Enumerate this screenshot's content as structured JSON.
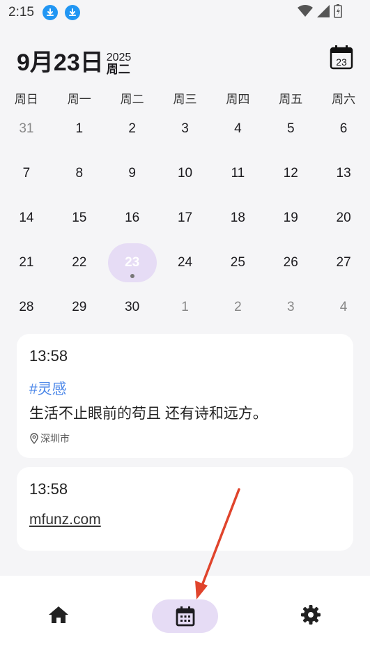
{
  "status": {
    "time": "2:15"
  },
  "header": {
    "date": "9月23日",
    "year": "2025",
    "weekday": "周二",
    "cal_icon_day": "23"
  },
  "weekdays": [
    "周日",
    "周一",
    "周二",
    "周三",
    "周四",
    "周五",
    "周六"
  ],
  "calendar": {
    "rows": [
      [
        "31",
        "1",
        "2",
        "3",
        "4",
        "5",
        "6"
      ],
      [
        "7",
        "8",
        "9",
        "10",
        "11",
        "12",
        "13"
      ],
      [
        "14",
        "15",
        "16",
        "17",
        "18",
        "19",
        "20"
      ],
      [
        "21",
        "22",
        "23",
        "24",
        "25",
        "26",
        "27"
      ],
      [
        "28",
        "29",
        "30",
        "1",
        "2",
        "3",
        "4"
      ]
    ],
    "selected": "23"
  },
  "notes": [
    {
      "time": "13:58",
      "tag": "#灵感",
      "text": "生活不止眼前的苟且 还有诗和远方。",
      "location": "深圳市"
    },
    {
      "time": "13:58",
      "link": "mfunz.com"
    }
  ],
  "colors": {
    "accent": "#e6dcf5",
    "tag": "#4a86e8",
    "arrow": "#e0442c"
  }
}
